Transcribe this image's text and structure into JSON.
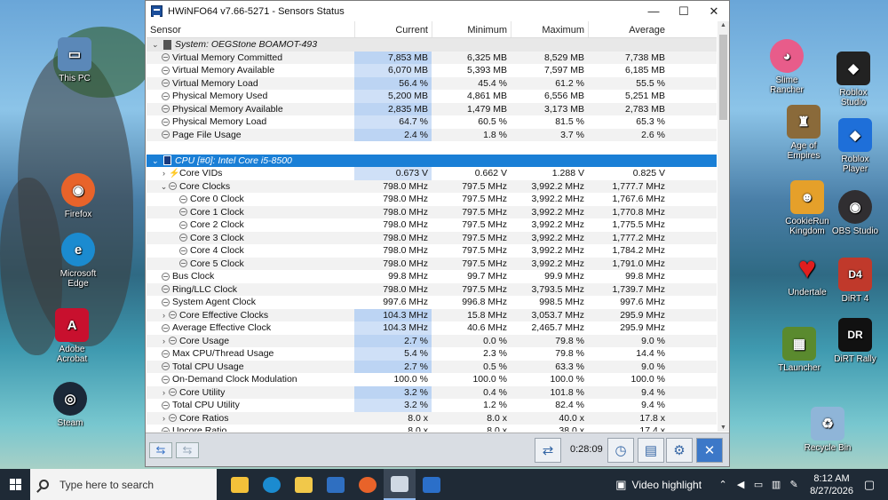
{
  "window": {
    "title": "HWiNFO64 v7.66-5271 - Sensors Status",
    "minimize": "—",
    "maximize": "☐",
    "close": "✕"
  },
  "columns": [
    "Sensor",
    "Current",
    "Minimum",
    "Maximum",
    "Average"
  ],
  "rows": [
    {
      "type": "group",
      "name": "System: OEGStone BOAMOT-493",
      "cur": "",
      "min": "",
      "max": "",
      "avg": ""
    },
    {
      "type": "item",
      "name": "Virtual Memory Committed",
      "cur": "7,853 MB",
      "min": "6,325 MB",
      "max": "8,529 MB",
      "avg": "7,738 MB"
    },
    {
      "type": "item",
      "name": "Virtual Memory Available",
      "cur": "6,070 MB",
      "min": "5,393 MB",
      "max": "7,597 MB",
      "avg": "6,185 MB"
    },
    {
      "type": "item",
      "name": "Virtual Memory Load",
      "cur": "56.4 %",
      "min": "45.4 %",
      "max": "61.2 %",
      "avg": "55.5 %"
    },
    {
      "type": "item",
      "name": "Physical Memory Used",
      "cur": "5,200 MB",
      "min": "4,861 MB",
      "max": "6,556 MB",
      "avg": "5,251 MB"
    },
    {
      "type": "item",
      "name": "Physical Memory Available",
      "cur": "2,835 MB",
      "min": "1,479 MB",
      "max": "3,173 MB",
      "avg": "2,783 MB"
    },
    {
      "type": "item",
      "name": "Physical Memory Load",
      "cur": "64.7 %",
      "min": "60.5 %",
      "max": "81.5 %",
      "avg": "65.3 %"
    },
    {
      "type": "item",
      "name": "Page File Usage",
      "cur": "2.4 %",
      "min": "1.8 %",
      "max": "3.7 %",
      "avg": "2.6 %"
    },
    {
      "type": "blank",
      "name": "",
      "cur": "",
      "min": "",
      "max": "",
      "avg": ""
    },
    {
      "type": "selected",
      "name": "CPU [#0]: Intel Core i5-8500",
      "cur": "",
      "min": "",
      "max": "",
      "avg": ""
    },
    {
      "type": "volt",
      "name": "Core VIDs",
      "cur": "0.673 V",
      "min": "0.662 V",
      "max": "1.288 V",
      "avg": "0.825 V",
      "expand": "›"
    },
    {
      "type": "item",
      "name": "Core Clocks",
      "cur": "798.0 MHz",
      "min": "797.5 MHz",
      "max": "3,992.2 MHz",
      "avg": "1,777.7 MHz",
      "expand": "⌄"
    },
    {
      "type": "child",
      "name": "Core 0 Clock",
      "cur": "798.0 MHz",
      "min": "797.5 MHz",
      "max": "3,992.2 MHz",
      "avg": "1,767.6 MHz"
    },
    {
      "type": "child",
      "name": "Core 1 Clock",
      "cur": "798.0 MHz",
      "min": "797.5 MHz",
      "max": "3,992.2 MHz",
      "avg": "1,770.8 MHz"
    },
    {
      "type": "child",
      "name": "Core 2 Clock",
      "cur": "798.0 MHz",
      "min": "797.5 MHz",
      "max": "3,992.2 MHz",
      "avg": "1,775.5 MHz"
    },
    {
      "type": "child",
      "name": "Core 3 Clock",
      "cur": "798.0 MHz",
      "min": "797.5 MHz",
      "max": "3,992.2 MHz",
      "avg": "1,777.2 MHz"
    },
    {
      "type": "child",
      "name": "Core 4 Clock",
      "cur": "798.0 MHz",
      "min": "797.5 MHz",
      "max": "3,992.2 MHz",
      "avg": "1,784.2 MHz"
    },
    {
      "type": "child",
      "name": "Core 5 Clock",
      "cur": "798.0 MHz",
      "min": "797.5 MHz",
      "max": "3,992.2 MHz",
      "avg": "1,791.0 MHz"
    },
    {
      "type": "item",
      "name": "Bus Clock",
      "cur": "99.8 MHz",
      "min": "99.7 MHz",
      "max": "99.9 MHz",
      "avg": "99.8 MHz"
    },
    {
      "type": "item",
      "name": "Ring/LLC Clock",
      "cur": "798.0 MHz",
      "min": "797.5 MHz",
      "max": "3,793.5 MHz",
      "avg": "1,739.7 MHz"
    },
    {
      "type": "item",
      "name": "System Agent Clock",
      "cur": "997.6 MHz",
      "min": "996.8 MHz",
      "max": "998.5 MHz",
      "avg": "997.6 MHz"
    },
    {
      "type": "item",
      "name": "Core Effective Clocks",
      "cur": "104.3 MHz",
      "min": "15.8 MHz",
      "max": "3,053.7 MHz",
      "avg": "295.9 MHz",
      "expand": "›"
    },
    {
      "type": "item",
      "name": "Average Effective Clock",
      "cur": "104.3 MHz",
      "min": "40.6 MHz",
      "max": "2,465.7 MHz",
      "avg": "295.9 MHz"
    },
    {
      "type": "item",
      "name": "Core Usage",
      "cur": "2.7 %",
      "min": "0.0 %",
      "max": "79.8 %",
      "avg": "9.0 %",
      "expand": "›"
    },
    {
      "type": "item",
      "name": "Max CPU/Thread Usage",
      "cur": "5.4 %",
      "min": "2.3 %",
      "max": "79.8 %",
      "avg": "14.4 %"
    },
    {
      "type": "item",
      "name": "Total CPU Usage",
      "cur": "2.7 %",
      "min": "0.5 %",
      "max": "63.3 %",
      "avg": "9.0 %"
    },
    {
      "type": "item",
      "name": "On-Demand Clock Modulation",
      "cur": "100.0 %",
      "min": "100.0 %",
      "max": "100.0 %",
      "avg": "100.0 %"
    },
    {
      "type": "item",
      "name": "Core Utility",
      "cur": "3.2 %",
      "min": "0.4 %",
      "max": "101.8 %",
      "avg": "9.4 %",
      "expand": "›"
    },
    {
      "type": "item",
      "name": "Total CPU Utility",
      "cur": "3.2 %",
      "min": "1.2 %",
      "max": "82.4 %",
      "avg": "9.4 %"
    },
    {
      "type": "item",
      "name": "Core Ratios",
      "cur": "8.0 x",
      "min": "8.0 x",
      "max": "40.0 x",
      "avg": "17.8 x",
      "expand": "›"
    },
    {
      "type": "item",
      "name": "Uncore Ratio",
      "cur": "8.0 x",
      "min": "8.0 x",
      "max": "38.0 x",
      "avg": "17.4 x"
    }
  ],
  "bottombar": {
    "timer": "0:28:09"
  },
  "desktop_icons": [
    {
      "label": "This PC",
      "color": "#5b88b8",
      "glyph": "▭"
    },
    {
      "label": "Firefox",
      "color": "#e8632a",
      "glyph": "◉"
    },
    {
      "label": "Microsoft Edge",
      "color": "#1b8bd0",
      "glyph": "e"
    },
    {
      "label": "Adobe Acrobat",
      "color": "#c8102e",
      "glyph": "A"
    },
    {
      "label": "Steam",
      "color": "#1b2838",
      "glyph": "◎"
    },
    {
      "label": "Slime Rancher",
      "color": "#e85c8a",
      "glyph": "◕"
    },
    {
      "label": "Roblox Studio",
      "color": "#222222",
      "glyph": "◆"
    },
    {
      "label": "Age of Empires",
      "color": "#8a6a3a",
      "glyph": "♜"
    },
    {
      "label": "Roblox Player",
      "color": "#1e6fd9",
      "glyph": "◆"
    },
    {
      "label": "CookieRun Kingdom",
      "color": "#e5a02a",
      "glyph": "☻"
    },
    {
      "label": "OBS Studio",
      "color": "#302e31",
      "glyph": "◉"
    },
    {
      "label": "Undertale",
      "color": "#e01e1e",
      "glyph": "♥"
    },
    {
      "label": "DiRT 4",
      "color": "#c0392b",
      "glyph": "D4"
    },
    {
      "label": "TLauncher",
      "color": "#5a8a2e",
      "glyph": "▦"
    },
    {
      "label": "DiRT Rally",
      "color": "#111111",
      "glyph": "DR"
    },
    {
      "label": "Recycle Bin",
      "color": "#8fb5d8",
      "glyph": "♻"
    }
  ],
  "taskbar": {
    "search_placeholder": "Type here to search",
    "video_highlight": "Video highlight",
    "time": "8:12 AM",
    "date": "8/27/2026"
  }
}
